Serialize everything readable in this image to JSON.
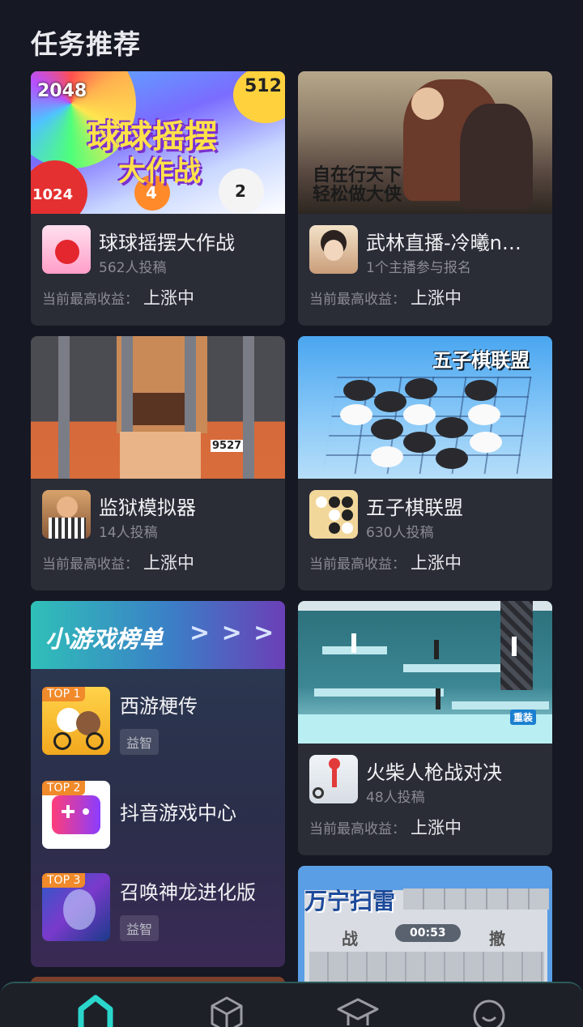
{
  "section_title": "任务推荐",
  "earn_label": "当前最高收益：",
  "cards": [
    {
      "cover_text": [
        "2048",
        "512",
        "1024",
        "4",
        "2",
        "球球摇摆",
        "大作战"
      ],
      "title": "球球摇摆大作战",
      "subtitle": "562人投稿",
      "earn_value": "上涨中"
    },
    {
      "cover_text": [
        "自在行天下",
        "轻松做大侠"
      ],
      "title": "武林直播-冷曦n…",
      "subtitle": "1个主播参与报名",
      "earn_value": "上涨中"
    },
    {
      "cover_text": [
        "9527"
      ],
      "title": "监狱模拟器",
      "subtitle": "14人投稿",
      "earn_value": "上涨中"
    },
    {
      "cover_text": [
        "五子棋联盟"
      ],
      "title": "五子棋联盟",
      "subtitle": "630人投稿",
      "earn_value": "上涨中"
    },
    {
      "cover_text": [
        "重装"
      ],
      "title": "火柴人枪战对决",
      "subtitle": "48人投稿",
      "earn_value": "上涨中"
    },
    {
      "cover_text": [
        "万宁扫雷",
        "战",
        "00:53",
        "撤"
      ]
    }
  ],
  "ranking": {
    "title": "小游戏榜单",
    "arrows": "> > >",
    "items": [
      {
        "rank": "TOP 1",
        "name": "西游梗传",
        "tag": "益智"
      },
      {
        "rank": "TOP 2",
        "name": "抖音游戏中心",
        "tag": ""
      },
      {
        "rank": "TOP 3",
        "name": "召唤神龙进化版",
        "tag": "益智"
      }
    ]
  },
  "bottom_nav": {
    "items": [
      "home-icon",
      "box-icon",
      "graduation-cap-icon",
      "profile-icon"
    ],
    "active_color": "#2ad6cb"
  }
}
